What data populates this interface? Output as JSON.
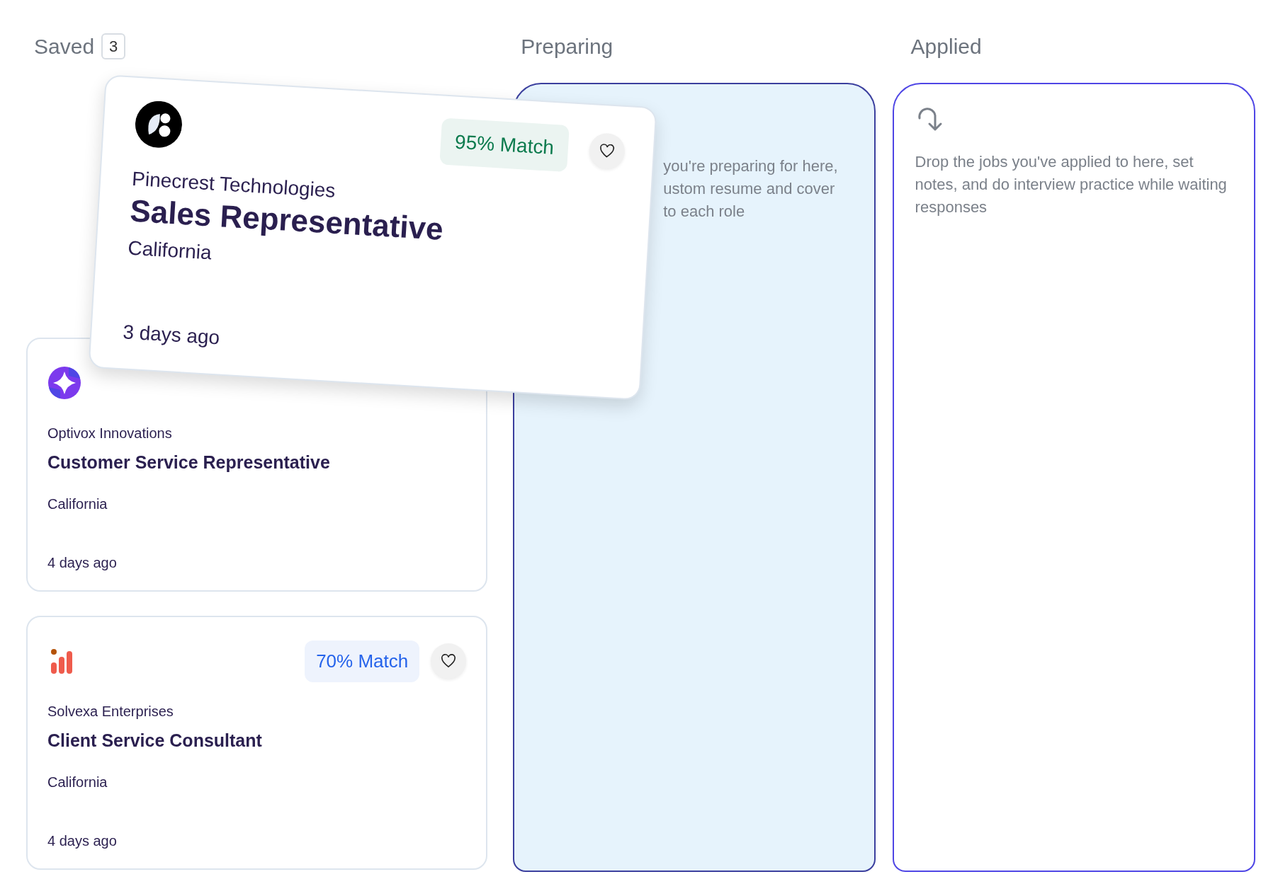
{
  "columns": [
    {
      "title": "Saved",
      "count": "3"
    },
    {
      "title": "Preparing",
      "highlighted": true,
      "lines": [
        "you're preparing for here,",
        "ustom resume and cover",
        "to each role"
      ]
    },
    {
      "title": "Applied",
      "highlighted": false,
      "description": "Drop the jobs you've applied to here, set notes, and do interview practice while waiting responses"
    }
  ],
  "dragged_card": {
    "company": "Pinecrest Technologies",
    "title": "Sales Representative",
    "location": "California",
    "posted": "3 days ago",
    "match": {
      "text": "95% Match",
      "color": "#0b7a4d"
    }
  },
  "saved_cards": [
    {
      "company": "Optivox Innovations",
      "title": "Customer Service Representative",
      "location": "California",
      "posted": "4 days ago"
    },
    {
      "company": "Solvexa Enterprises",
      "title": "Client Service Consultant",
      "location": "California",
      "posted": "4 days ago",
      "match": {
        "text": "70% Match",
        "color": "#2563eb"
      }
    }
  ]
}
